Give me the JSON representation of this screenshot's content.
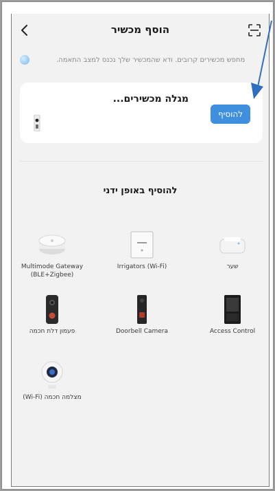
{
  "header": {
    "title": "הוסף מכשיר"
  },
  "search": {
    "status_text": "מחפש מכשירים קרובים. ודא שהמכשיר שלך נכנס למצב התאמה."
  },
  "discover": {
    "title": "מגלה מכשירים...",
    "add_label": "להוסיף"
  },
  "manual": {
    "title": "להוסיף באופן ידני"
  },
  "devices": [
    {
      "label": "Multimode Gateway (BLE+Zigbee)",
      "icon": "gateway-icon"
    },
    {
      "label": "Irrigators (Wi-Fi)",
      "icon": "irrigator-icon"
    },
    {
      "label": "שער",
      "icon": "gate-hub-icon"
    },
    {
      "label": "פעמון דלת חכמה",
      "icon": "smart-doorbell-icon"
    },
    {
      "label": "Doorbell Camera",
      "icon": "doorbell-camera-icon"
    },
    {
      "label": "Access Control",
      "icon": "access-control-icon"
    },
    {
      "label": "מצלמה חכמה (Wi-Fi)",
      "icon": "smart-camera-icon"
    }
  ],
  "colors": {
    "accent": "#3f8fdf",
    "background": "#f2f2f2",
    "card": "#ffffff"
  }
}
